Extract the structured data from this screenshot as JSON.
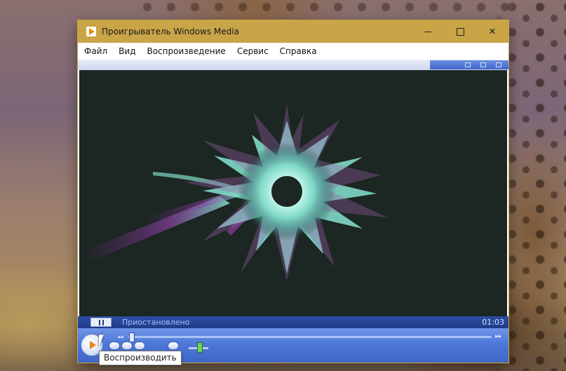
{
  "window": {
    "title": "Проигрыватель Windows Media",
    "minimize_icon": "minimize-icon",
    "maximize_icon": "maximize-icon",
    "close_glyph": "✕"
  },
  "menu": {
    "items": [
      "Файл",
      "Вид",
      "Воспроизведение",
      "Сервис",
      "Справка"
    ]
  },
  "status": {
    "state": "Приостановлено",
    "time": "01:03"
  },
  "controls": {
    "play_tooltip": "Воспроизводить",
    "rewind_glyph": "◂◂",
    "fast_forward_glyph": "▸▸"
  },
  "colors": {
    "titlebar": "#c9a548",
    "player_blue": "#4d78d8",
    "status_bar": "#1f3c88",
    "visualization_bg": "#1c2622",
    "visualization_glow": "#9fe8d8"
  }
}
